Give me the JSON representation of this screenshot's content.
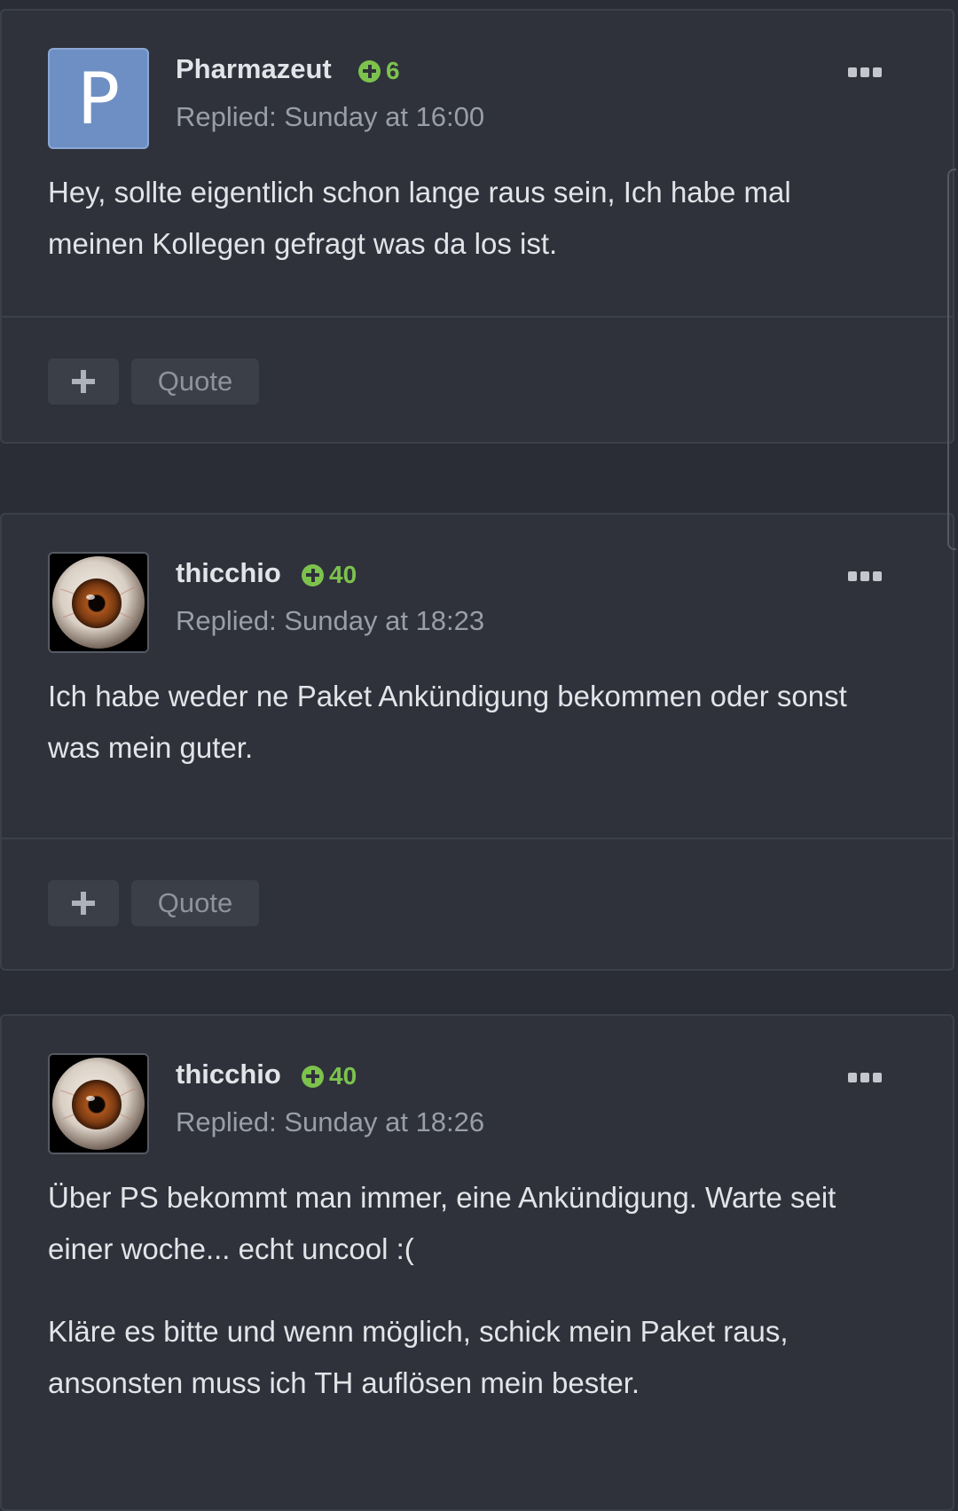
{
  "posts": [
    {
      "author": "Pharmazeut",
      "avatar_letter": "P",
      "avatar_color": "#6d8fc4",
      "reputation": "6",
      "replied": "Replied: Sunday at 16:00",
      "paragraphs": [
        "Hey, sollte eigentlich schon lange raus sein, Ich habe mal meinen Kollegen gefragt was da los ist."
      ],
      "quote_label": "Quote"
    },
    {
      "author": "thicchio",
      "avatar_icon": "eyeball-avatar",
      "reputation": "40",
      "replied": "Replied: Sunday at 18:23",
      "paragraphs": [
        "Ich habe weder ne Paket Ankündigung bekommen oder sonst was mein guter."
      ],
      "quote_label": "Quote"
    },
    {
      "author": "thicchio",
      "avatar_icon": "eyeball-avatar",
      "reputation": "40",
      "replied": "Replied: Sunday at 18:26",
      "paragraphs": [
        "Über PS bekommt man immer, eine Ankündigung. Warte seit einer woche... echt uncool :(",
        "Kläre es bitte und wenn möglich, schick mein Paket raus, ansonsten muss ich TH auflösen mein bester."
      ]
    }
  ],
  "icons": {
    "reputation": "plus-circle-icon",
    "more": "ellipsis-icon",
    "react": "plus-icon"
  },
  "colors": {
    "background": "#2a2d36",
    "card": "#2f323b",
    "reputation_green": "#7cc24d",
    "text": "#e2e4e8",
    "muted": "#9a9ea8"
  }
}
